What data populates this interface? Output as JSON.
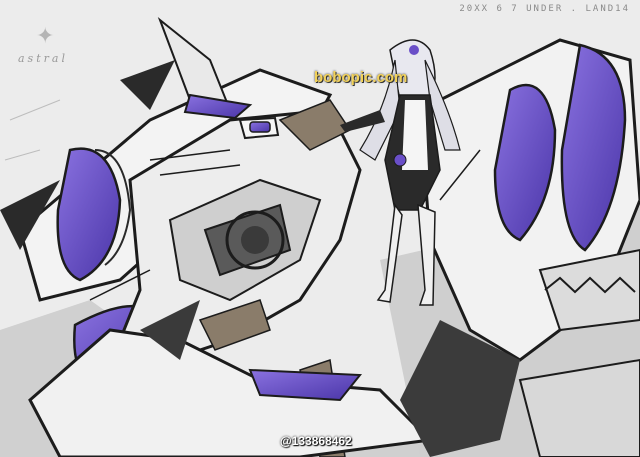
{
  "artwork": {
    "top_code": "20XX 6 7 UNDER . LAND14",
    "signature_word": "astral",
    "watermark": "bobopic.com",
    "credit": "@133868462"
  },
  "colors": {
    "background": "#ececec",
    "accent_purple": "#6a4fc8",
    "armor_white": "#f4f4f4",
    "line_black": "#1c1c1c",
    "tan": "#8a7c6a"
  }
}
